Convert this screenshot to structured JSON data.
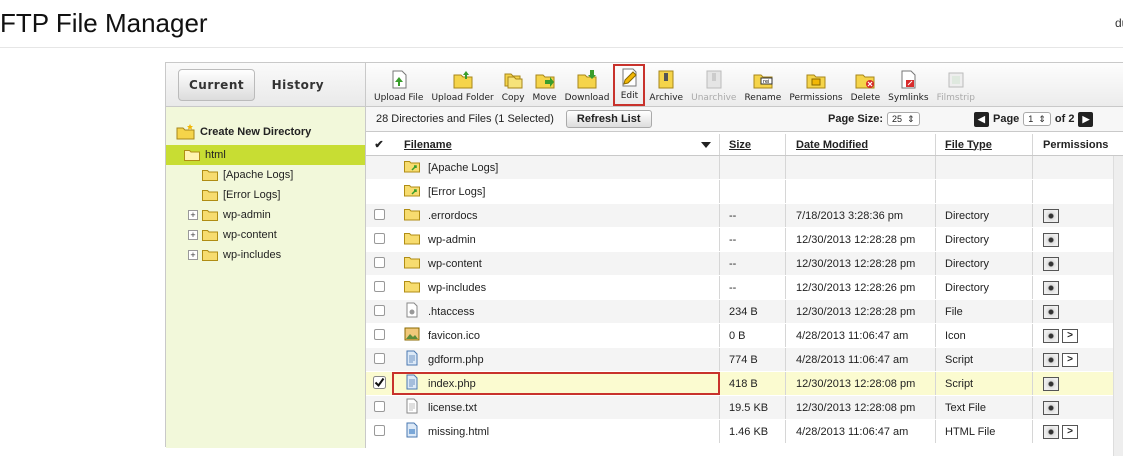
{
  "header": {
    "title": "FTP File Manager",
    "user": "du"
  },
  "tabs": [
    {
      "label": "Current"
    },
    {
      "label": "History"
    }
  ],
  "left": {
    "create_dir": "Create New Directory",
    "tree": [
      {
        "label": "html",
        "selected": true,
        "indent": 0,
        "expand": ""
      },
      {
        "label": "[Apache Logs]",
        "indent": 1,
        "expand": ""
      },
      {
        "label": "[Error Logs]",
        "indent": 1,
        "expand": ""
      },
      {
        "label": "wp-admin",
        "indent": 1,
        "expand": "+"
      },
      {
        "label": "wp-content",
        "indent": 1,
        "expand": "+"
      },
      {
        "label": "wp-includes",
        "indent": 1,
        "expand": "+"
      }
    ]
  },
  "toolbar": [
    {
      "label": "Upload File",
      "icon": "upload-file-icon"
    },
    {
      "label": "Upload Folder",
      "icon": "upload-folder-icon"
    },
    {
      "label": "Copy",
      "icon": "copy-icon"
    },
    {
      "label": "Move",
      "icon": "move-icon"
    },
    {
      "label": "Download",
      "icon": "download-icon"
    },
    {
      "label": "Edit",
      "icon": "edit-icon",
      "highlight": true
    },
    {
      "label": "Archive",
      "icon": "archive-icon"
    },
    {
      "label": "Unarchive",
      "icon": "unarchive-icon",
      "disabled": true
    },
    {
      "label": "Rename",
      "icon": "rename-icon"
    },
    {
      "label": "Permissions",
      "icon": "permissions-icon"
    },
    {
      "label": "Delete",
      "icon": "delete-icon"
    },
    {
      "label": "Symlinks",
      "icon": "symlinks-icon"
    },
    {
      "label": "Filmstrip",
      "icon": "filmstrip-icon",
      "disabled": true
    }
  ],
  "info": {
    "summary": "28 Directories and Files (1 Selected)",
    "refresh": "Refresh List",
    "page_size_label": "Page Size:",
    "page_size": "25",
    "page_label": "Page",
    "page": "1",
    "of": "of 2"
  },
  "columns": {
    "filename": "Filename",
    "size": "Size",
    "modified": "Date Modified",
    "type": "File Type",
    "perms": "Permissions"
  },
  "rows": [
    {
      "name": "[Apache Logs]",
      "size": "",
      "date": "",
      "type": "",
      "icon": "folder-link",
      "check": false,
      "nocheck": true,
      "perm": []
    },
    {
      "name": "[Error Logs]",
      "size": "",
      "date": "",
      "type": "",
      "icon": "folder-link",
      "check": false,
      "nocheck": true,
      "perm": []
    },
    {
      "name": ".errordocs",
      "size": "--",
      "date": "7/18/2013 3:28:36 pm",
      "type": "Directory",
      "icon": "folder",
      "check": false,
      "perm": [
        "eye"
      ]
    },
    {
      "name": "wp-admin",
      "size": "--",
      "date": "12/30/2013 12:28:28 pm",
      "type": "Directory",
      "icon": "folder",
      "check": false,
      "perm": [
        "eye"
      ]
    },
    {
      "name": "wp-content",
      "size": "--",
      "date": "12/30/2013 12:28:28 pm",
      "type": "Directory",
      "icon": "folder",
      "check": false,
      "perm": [
        "eye"
      ]
    },
    {
      "name": "wp-includes",
      "size": "--",
      "date": "12/30/2013 12:28:26 pm",
      "type": "Directory",
      "icon": "folder",
      "check": false,
      "perm": [
        "eye"
      ]
    },
    {
      "name": ".htaccess",
      "size": "234 B",
      "date": "12/30/2013 12:28:28 pm",
      "type": "File",
      "icon": "gear-file",
      "check": false,
      "perm": [
        "eye"
      ]
    },
    {
      "name": "favicon.ico",
      "size": "0 B",
      "date": "4/28/2013 11:06:47 am",
      "type": "Icon",
      "icon": "image",
      "check": false,
      "perm": [
        "eye",
        "go"
      ]
    },
    {
      "name": "gdform.php",
      "size": "774 B",
      "date": "4/28/2013 11:06:47 am",
      "type": "Script",
      "icon": "script",
      "check": false,
      "perm": [
        "eye",
        "go"
      ]
    },
    {
      "name": "index.php",
      "size": "418 B",
      "date": "12/30/2013 12:28:08 pm",
      "type": "Script",
      "icon": "script",
      "check": true,
      "selected": true,
      "perm": [
        "eye"
      ]
    },
    {
      "name": "license.txt",
      "size": "19.5 KB",
      "date": "12/30/2013 12:28:08 pm",
      "type": "Text File",
      "icon": "text",
      "check": false,
      "perm": [
        "eye"
      ]
    },
    {
      "name": "missing.html",
      "size": "1.46 KB",
      "date": "4/28/2013 11:06:47 am",
      "type": "HTML File",
      "icon": "html",
      "check": false,
      "perm": [
        "eye",
        "go"
      ]
    }
  ]
}
